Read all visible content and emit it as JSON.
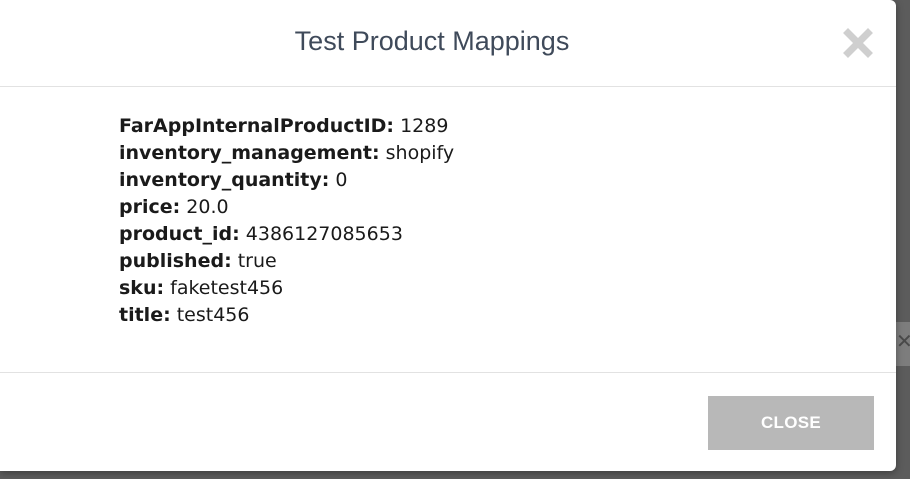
{
  "modal": {
    "title": "Test Product Mappings",
    "close_icon": "close-x-icon",
    "close_button_label": "CLOSE",
    "fields": [
      {
        "key": "FarAppInternalProductID:",
        "value": "1289"
      },
      {
        "key": "inventory_management:",
        "value": "shopify"
      },
      {
        "key": "inventory_quantity:",
        "value": "0"
      },
      {
        "key": "price:",
        "value": "20.0"
      },
      {
        "key": "product_id:",
        "value": "4386127085653"
      },
      {
        "key": "published:",
        "value": "true"
      },
      {
        "key": "sku:",
        "value": "faketest456"
      },
      {
        "key": "title:",
        "value": "test456"
      }
    ]
  },
  "background": {
    "close_glyph": "✕"
  },
  "colors": {
    "title": "#3f4a5a",
    "close_icon": "#cfcfcf",
    "button_bg": "#b8b8b8",
    "overlay": "#5c5c5c"
  }
}
